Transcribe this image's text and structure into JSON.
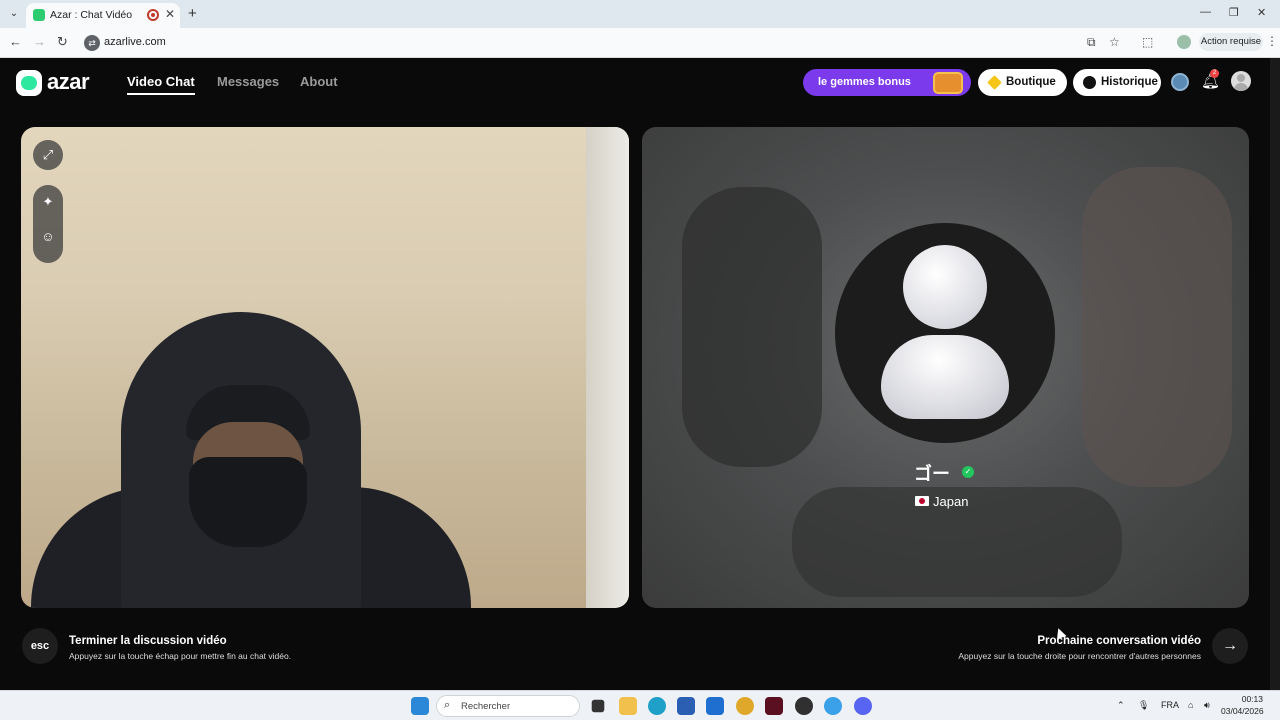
{
  "browser": {
    "tab_title": "Azar : Chat Vidéo avec de",
    "tab_close": "✕",
    "new_tab": "+",
    "url": "azarlive.com",
    "action_required": "Action requise",
    "window_controls": [
      "—",
      "❐",
      "✕"
    ]
  },
  "header": {
    "logo_text": "azar",
    "nav": [
      {
        "label": "Video Chat",
        "active": true
      },
      {
        "label": "Messages",
        "active": false
      },
      {
        "label": "About",
        "active": false
      }
    ],
    "bonus_label": "le gemmes bonus",
    "shop_label": "Boutique",
    "history_label": "Historique",
    "notification_count": "2",
    "icons": [
      "globe-icon",
      "bell-icon",
      "profile-avatar"
    ]
  },
  "left_panel": {
    "controls": [
      {
        "name": "expand-icon",
        "glyph": "⤢"
      },
      {
        "name": "magic-wand-icon",
        "glyph": "✦"
      },
      {
        "name": "face-filter-icon",
        "glyph": "☺"
      }
    ]
  },
  "right_panel": {
    "peer_name": "ゴー",
    "verified_glyph": "✓",
    "country": "Japan"
  },
  "controls": {
    "esc_key": "esc",
    "end_title": "Terminer la discussion vidéo",
    "end_subtitle": "Appuyez sur la touche échap pour mettre fin au chat vidéo.",
    "next_title": "Prochaine conversation vidéo",
    "next_subtitle": "Appuyez sur la touche droite pour rencontrer d'autres personnes",
    "next_glyph": "→"
  },
  "taskbar": {
    "search_placeholder": "Rechercher",
    "language": "FRA",
    "time": "00:13",
    "date": "03/04/2026"
  },
  "colors": {
    "accent_purple": "#7c3aed",
    "brand_green": "#2ee8a0",
    "background": "#0a0a0a"
  }
}
